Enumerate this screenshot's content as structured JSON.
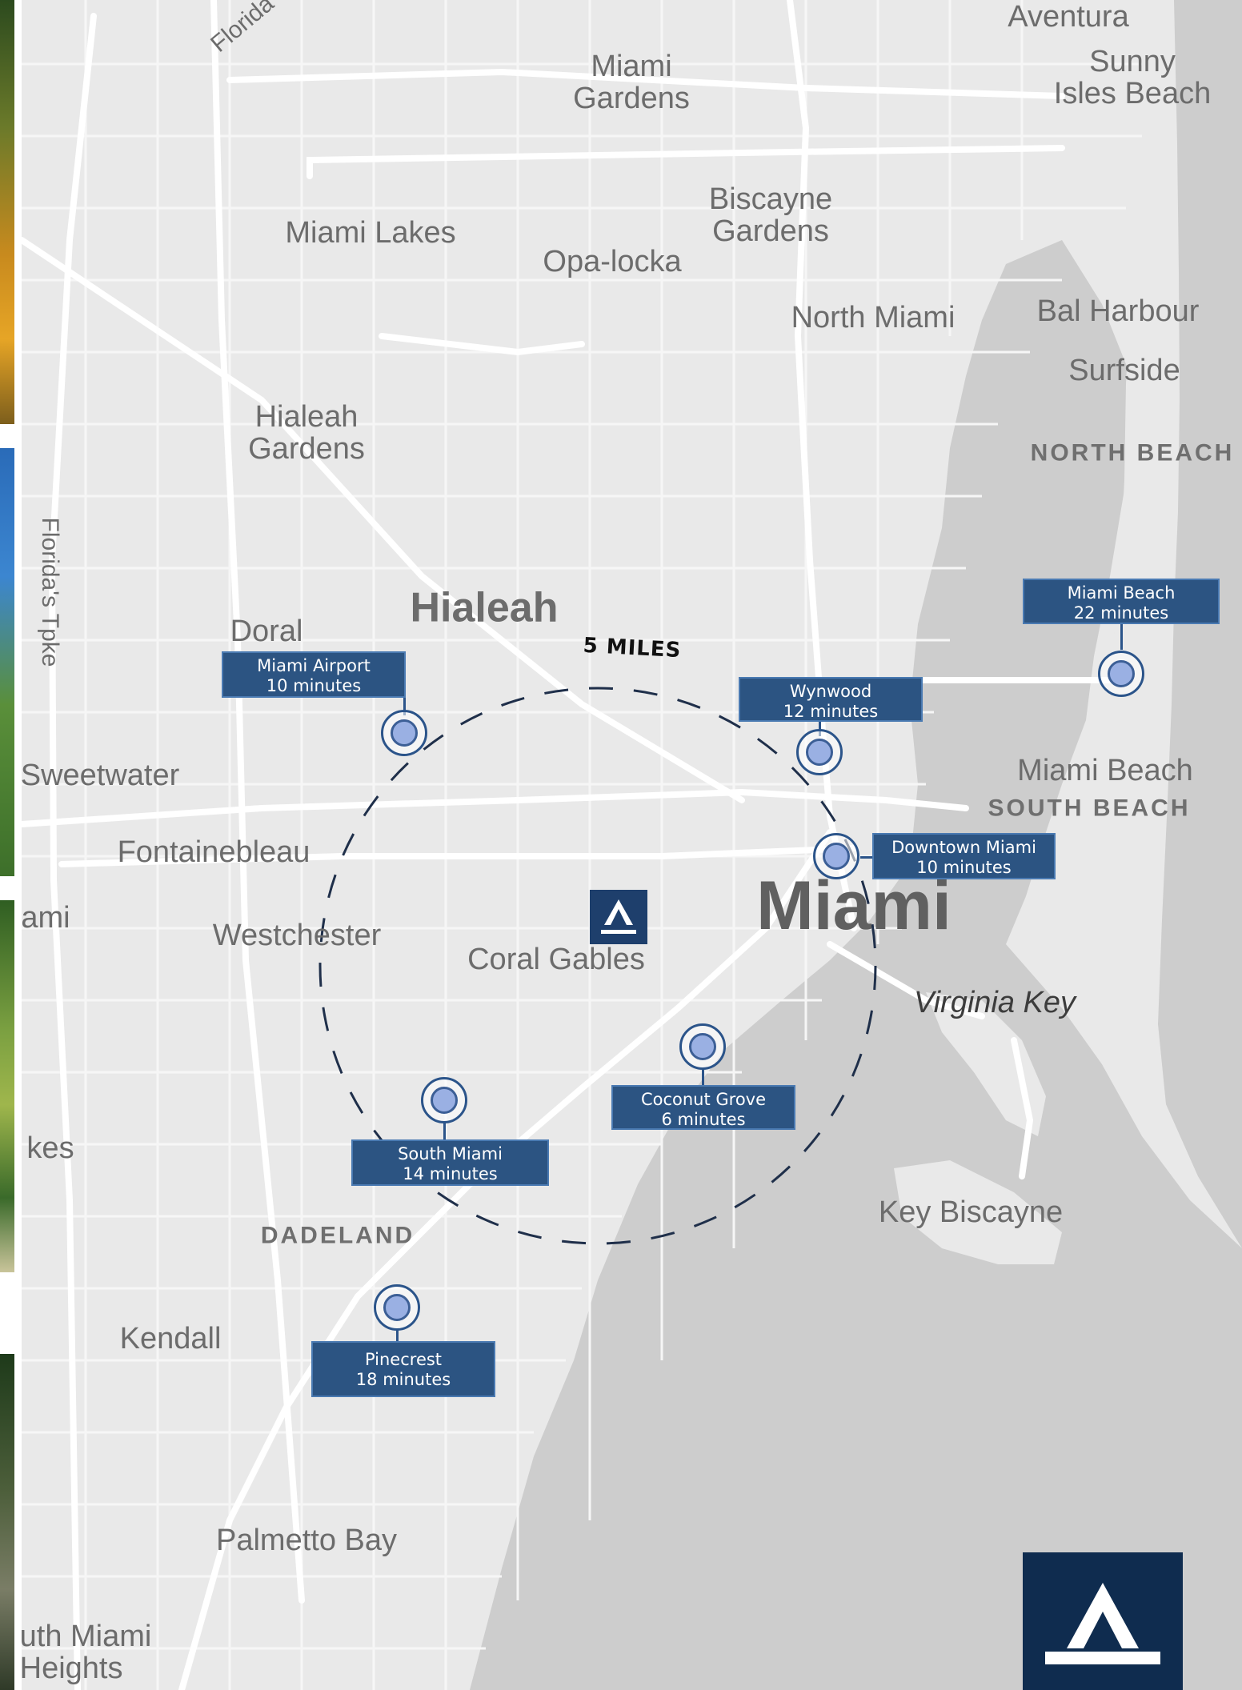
{
  "brand_colors": {
    "callout_fill": "#2c5482",
    "callout_border": "#4a7ab2",
    "pin_fill": "#9ab0e3",
    "pin_ring": "#2b548a",
    "logo_navy": "#0f2c4f",
    "center_marker": "#1e3f6c",
    "map_land": "#e9e9e9",
    "map_water": "#cdcdcd",
    "map_road": "#ffffff"
  },
  "map": {
    "radius_label": "5 MILES",
    "places": [
      {
        "id": "aventura",
        "text": "Aventura"
      },
      {
        "id": "sunny-isles-beach",
        "text": "Sunny\nIsles Beach"
      },
      {
        "id": "miami-gardens",
        "text": "Miami\nGardens"
      },
      {
        "id": "florida-tpke-top",
        "text": "Florida"
      },
      {
        "id": "biscayne-gardens",
        "text": "Biscayne\nGardens"
      },
      {
        "id": "miami-lakes",
        "text": "Miami Lakes"
      },
      {
        "id": "opa-locka",
        "text": "Opa-locka"
      },
      {
        "id": "north-miami",
        "text": "North Miami"
      },
      {
        "id": "bal-harbour",
        "text": "Bal Harbour"
      },
      {
        "id": "surfside",
        "text": "Surfside"
      },
      {
        "id": "hialeah-gardens",
        "text": "Hialeah\nGardens"
      },
      {
        "id": "north-beach",
        "text": "NORTH BEACH"
      },
      {
        "id": "floridas-tpke",
        "text": "Florida's Tpke"
      },
      {
        "id": "hialeah",
        "text": "Hialeah"
      },
      {
        "id": "doral",
        "text": "Doral"
      },
      {
        "id": "sweetwater",
        "text": "Sweetwater"
      },
      {
        "id": "miami-beach",
        "text": "Miami Beach"
      },
      {
        "id": "south-beach",
        "text": "SOUTH BEACH"
      },
      {
        "id": "fontainebleau",
        "text": "Fontainebleau"
      },
      {
        "id": "miami-west",
        "text": "ami"
      },
      {
        "id": "miami",
        "text": "Miami"
      },
      {
        "id": "westchester",
        "text": "Westchester"
      },
      {
        "id": "coral-gables",
        "text": "Coral Gables"
      },
      {
        "id": "virginia-key",
        "text": "Virginia Key"
      },
      {
        "id": "kes",
        "text": "kes"
      },
      {
        "id": "key-biscayne",
        "text": "Key Biscayne"
      },
      {
        "id": "dadeland",
        "text": "DADELAND"
      },
      {
        "id": "kendall",
        "text": "Kendall"
      },
      {
        "id": "palmetto-bay",
        "text": "Palmetto Bay"
      },
      {
        "id": "south-miami-heights",
        "text": "uth Miami\nHeights"
      }
    ],
    "destinations": [
      {
        "id": "miami-airport",
        "name": "Miami Airport",
        "time": "10 minutes"
      },
      {
        "id": "wynwood",
        "name": "Wynwood",
        "time": "12 minutes"
      },
      {
        "id": "miami-beach",
        "name": "Miami Beach",
        "time": "22 minutes"
      },
      {
        "id": "downtown-miami",
        "name": "Downtown Miami",
        "time": "10 minutes"
      },
      {
        "id": "coconut-grove",
        "name": "Coconut Grove",
        "time": "6 minutes"
      },
      {
        "id": "south-miami",
        "name": "South Miami",
        "time": "14 minutes"
      },
      {
        "id": "pinecrest",
        "name": "Pinecrest",
        "time": "18 minutes"
      }
    ]
  }
}
